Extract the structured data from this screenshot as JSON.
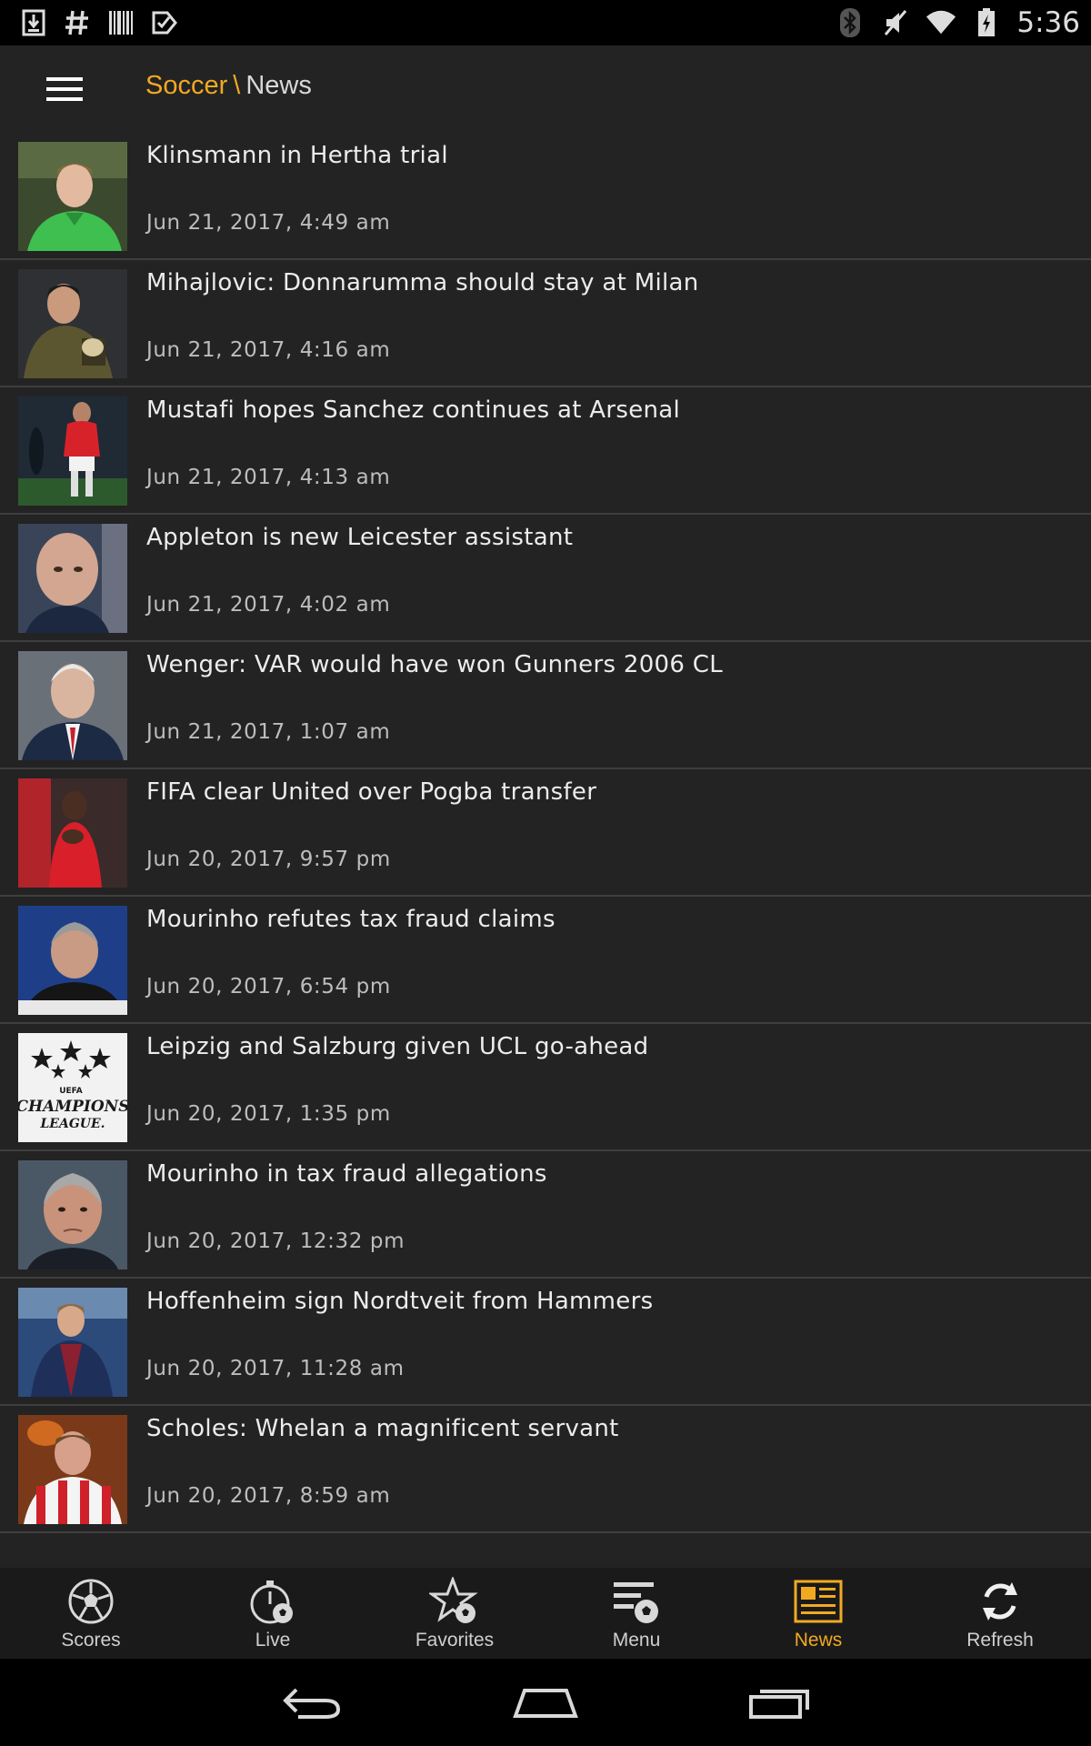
{
  "status_bar": {
    "left_icons": [
      "download-icon",
      "hashtag-icon",
      "barcode-icon",
      "task-check-icon"
    ],
    "right_icons": [
      "bluetooth-icon",
      "mute-icon",
      "wifi-icon",
      "battery-icon"
    ],
    "time": "5:36"
  },
  "app_bar": {
    "menu_icon": "hamburger-icon",
    "section": "Soccer",
    "separator": "\\",
    "page": "News"
  },
  "news": [
    {
      "headline": "Klinsmann in Hertha trial",
      "time": "Jun 21, 2017, 4:49 am"
    },
    {
      "headline": "Mihajlovic: Donnarumma should stay at Milan",
      "time": "Jun 21, 2017, 4:16 am"
    },
    {
      "headline": "Mustafi hopes Sanchez continues at Arsenal",
      "time": "Jun 21, 2017, 4:13 am"
    },
    {
      "headline": "Appleton is new Leicester assistant",
      "time": "Jun 21, 2017, 4:02 am"
    },
    {
      "headline": "Wenger: VAR would have won Gunners 2006 CL",
      "time": "Jun 21, 2017, 1:07 am"
    },
    {
      "headline": "FIFA clear United over Pogba transfer",
      "time": "Jun 20, 2017, 9:57 pm"
    },
    {
      "headline": "Mourinho refutes tax fraud claims",
      "time": "Jun 20, 2017, 6:54 pm"
    },
    {
      "headline": "Leipzig and Salzburg given UCL go-ahead",
      "time": "Jun 20, 2017, 1:35 pm"
    },
    {
      "headline": "Mourinho in tax fraud allegations",
      "time": "Jun 20, 2017, 12:32 pm"
    },
    {
      "headline": "Hoffenheim sign Nordtveit from Hammers",
      "time": "Jun 20, 2017, 11:28 am"
    },
    {
      "headline": "Scholes: Whelan a magnificent servant",
      "time": "Jun 20, 2017, 8:59 am"
    }
  ],
  "ucl_thumb_text": [
    "UEFA",
    "CHAMPIONS",
    "LEAGUE."
  ],
  "tabs": [
    {
      "label": "Scores",
      "icon": "soccer-ball-icon",
      "active": false
    },
    {
      "label": "Live",
      "icon": "stopwatch-ball-icon",
      "active": false
    },
    {
      "label": "Favorites",
      "icon": "star-ball-icon",
      "active": false
    },
    {
      "label": "Menu",
      "icon": "menu-ball-icon",
      "active": false
    },
    {
      "label": "News",
      "icon": "newspaper-icon",
      "active": true
    },
    {
      "label": "Refresh",
      "icon": "refresh-icon",
      "active": false
    }
  ],
  "nav_bar": [
    "back-icon",
    "home-icon",
    "recents-icon"
  ],
  "colors": {
    "accent": "#f2a922",
    "background": "#232323",
    "divider": "#3e3e3e",
    "tab_bar": "#1a1a1a"
  }
}
